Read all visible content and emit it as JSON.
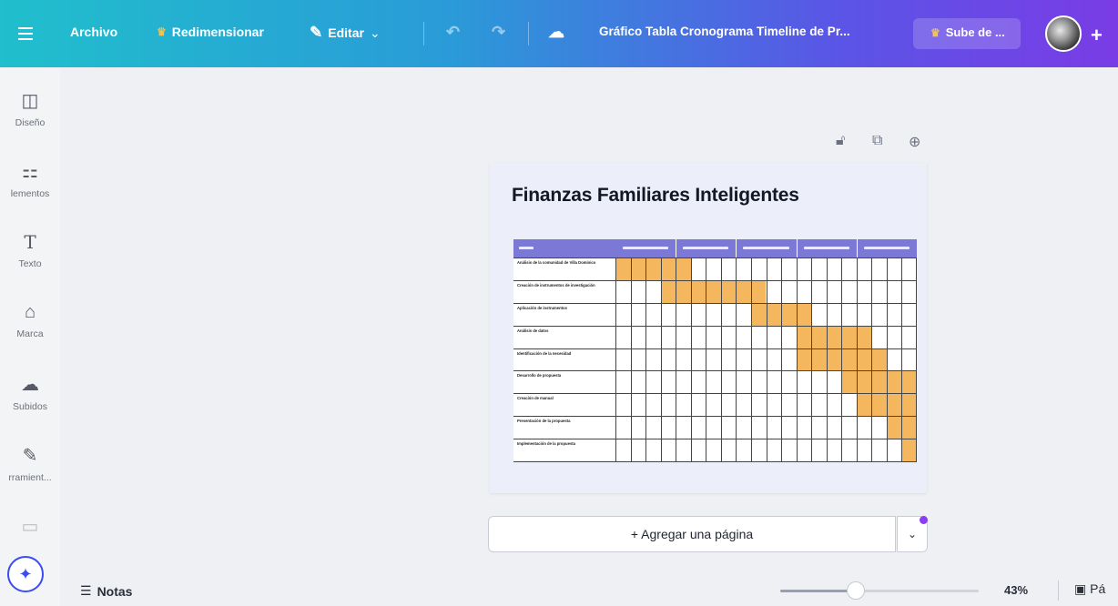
{
  "topbar": {
    "file": "Archivo",
    "resize": "Redimensionar",
    "edit": "Editar",
    "title": "Gráfico Tabla Cronograma Timeline de Pr...",
    "upgrade": "Sube de ..."
  },
  "sidebar": {
    "items": [
      {
        "label": "Diseño",
        "icon": "layout-icon"
      },
      {
        "label": "lementos",
        "icon": "shapes-icon"
      },
      {
        "label": "Texto",
        "icon": "text-icon"
      },
      {
        "label": "Marca",
        "icon": "brand-icon"
      },
      {
        "label": "Subidos",
        "icon": "upload-cloud-icon"
      },
      {
        "label": "rramient...",
        "icon": "tools-icon"
      }
    ]
  },
  "page": {
    "title": "Finanzas Familiares Inteligentes"
  },
  "gantt": {
    "columns": 20,
    "tasks": [
      {
        "name": "Análisis de la comunidad de Villa Dominico",
        "start": 0,
        "end": 5
      },
      {
        "name": "Creación de instrumentos de investigación",
        "start": 3,
        "end": 10
      },
      {
        "name": "Aplicación de instrumentos",
        "start": 9,
        "end": 13
      },
      {
        "name": "Análisis de datos",
        "start": 12,
        "end": 17
      },
      {
        "name": "Identificación de la necesidad",
        "start": 12,
        "end": 18
      },
      {
        "name": "Desarrollo de propuesta",
        "start": 15,
        "end": 20
      },
      {
        "name": "Creación de manual",
        "start": 16,
        "end": 20
      },
      {
        "name": "Presentación de la propuesta",
        "start": 18,
        "end": 20
      },
      {
        "name": "Implementación de la propuesta",
        "start": 19,
        "end": 20
      }
    ],
    "fill_color": "#f5b75e",
    "header_color": "#7c79d6"
  },
  "canvas": {
    "add_page": "+ Agregar una página"
  },
  "footer": {
    "notes": "Notas",
    "zoom": "43%",
    "zoom_level": 0.38,
    "pages": "Pá"
  },
  "colors": {
    "accent": "#3b4cf2",
    "purple_dot": "#8b3cf5"
  }
}
